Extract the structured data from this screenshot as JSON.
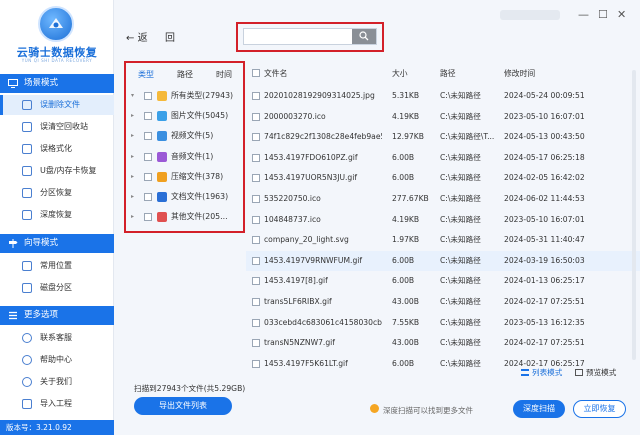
{
  "app": {
    "name": "云骑士数据恢复",
    "subtitle": "YUN QI SHI DATA RECOVERY",
    "version": "版本号：3.21.0.92"
  },
  "sidebar": {
    "sections": [
      {
        "title": "场景模式",
        "items": [
          {
            "label": "误删除文件",
            "active": true
          },
          {
            "label": "误清空回收站"
          },
          {
            "label": "误格式化"
          },
          {
            "label": "U盘/内存卡恢复"
          },
          {
            "label": "分区恢复"
          },
          {
            "label": "深度恢复"
          }
        ]
      },
      {
        "title": "向导模式",
        "items": [
          {
            "label": "常用位置"
          },
          {
            "label": "磁盘分区"
          }
        ]
      },
      {
        "title": "更多选项",
        "items": [
          {
            "label": "联系客服"
          },
          {
            "label": "帮助中心"
          },
          {
            "label": "关于我们"
          },
          {
            "label": "导入工程"
          }
        ]
      }
    ]
  },
  "toolbar": {
    "back_label": "返",
    "home_label": "回",
    "search_placeholder": ""
  },
  "tree": {
    "tabs": [
      "类型",
      "路径",
      "时间"
    ],
    "items": [
      {
        "label": "所有类型(27943)",
        "icon": "folder-icon",
        "color": "#f5b93a"
      },
      {
        "label": "图片文件(5045)",
        "icon": "image-icon",
        "color": "#3aa0e8"
      },
      {
        "label": "视频文件(5)",
        "icon": "video-icon",
        "color": "#3a8fe0"
      },
      {
        "label": "音频文件(1)",
        "icon": "music-icon",
        "color": "#9b59d6"
      },
      {
        "label": "压缩文件(378)",
        "icon": "archive-icon",
        "color": "#f0a020"
      },
      {
        "label": "文档文件(1963)",
        "icon": "document-icon",
        "color": "#2a6fd6"
      },
      {
        "label": "其他文件(205...",
        "icon": "other-files-icon",
        "color": "#e05050"
      }
    ]
  },
  "table": {
    "columns": [
      "文件名",
      "大小",
      "路径",
      "修改时间"
    ],
    "rows": [
      {
        "name": "20201028192909314025.jpg",
        "size": "5.31KB",
        "path": "C:\\未知路径",
        "time": "2024-05-24 00:09:51"
      },
      {
        "name": "2000003270.ico",
        "size": "4.19KB",
        "path": "C:\\未知路径",
        "time": "2023-05-10 16:07:01"
      },
      {
        "name": "74f1c829c2f1308c28e4feb9ae5...",
        "size": "12.97KB",
        "path": "C:\\未知路径\\T...",
        "time": "2024-05-13 00:43:50"
      },
      {
        "name": "1453.4197FDO610PZ.gif",
        "size": "6.00B",
        "path": "C:\\未知路径",
        "time": "2024-05-17 06:25:18"
      },
      {
        "name": "1453.4197UOR5N3JU.gif",
        "size": "6.00B",
        "path": "C:\\未知路径",
        "time": "2024-02-05 16:42:02"
      },
      {
        "name": "535220750.ico",
        "size": "277.67KB",
        "path": "C:\\未知路径",
        "time": "2024-06-02 11:44:53"
      },
      {
        "name": "104848737.ico",
        "size": "4.19KB",
        "path": "C:\\未知路径",
        "time": "2023-05-10 16:07:01"
      },
      {
        "name": "company_20_light.svg",
        "size": "1.97KB",
        "path": "C:\\未知路径",
        "time": "2024-05-31 11:40:47"
      },
      {
        "name": "1453.4197V9RNWFUM.gif",
        "size": "6.00B",
        "path": "C:\\未知路径",
        "time": "2024-03-19 16:50:03",
        "selected": true
      },
      {
        "name": "1453.4197[8].gif",
        "size": "6.00B",
        "path": "C:\\未知路径",
        "time": "2024-01-13 06:25:17"
      },
      {
        "name": "trans5LF6RIBX.gif",
        "size": "43.00B",
        "path": "C:\\未知路径",
        "time": "2024-02-17 07:25:51"
      },
      {
        "name": "033cebd4c683061c4158030cb...",
        "size": "7.55KB",
        "path": "C:\\未知路径",
        "time": "2023-05-13 16:12:35"
      },
      {
        "name": "transN5NZNW7.gif",
        "size": "43.00B",
        "path": "C:\\未知路径",
        "time": "2024-02-17 07:25:51"
      },
      {
        "name": "1453.4197F5K61LT.gif",
        "size": "6.00B",
        "path": "C:\\未知路径",
        "time": "2024-02-17 06:25:17"
      }
    ]
  },
  "view": {
    "list_label": "列表模式",
    "preview_label": "预览模式"
  },
  "footer": {
    "scan_summary": "扫描到27943个文件(共5.29GB)",
    "export_label": "导出文件列表",
    "deep_tip": "深度扫描可以找到更多文件",
    "deep_scan_label": "深度扫描",
    "recover_label": "立即恢复"
  },
  "colors": {
    "accent": "#1a73e8",
    "highlight": "#d32029"
  }
}
